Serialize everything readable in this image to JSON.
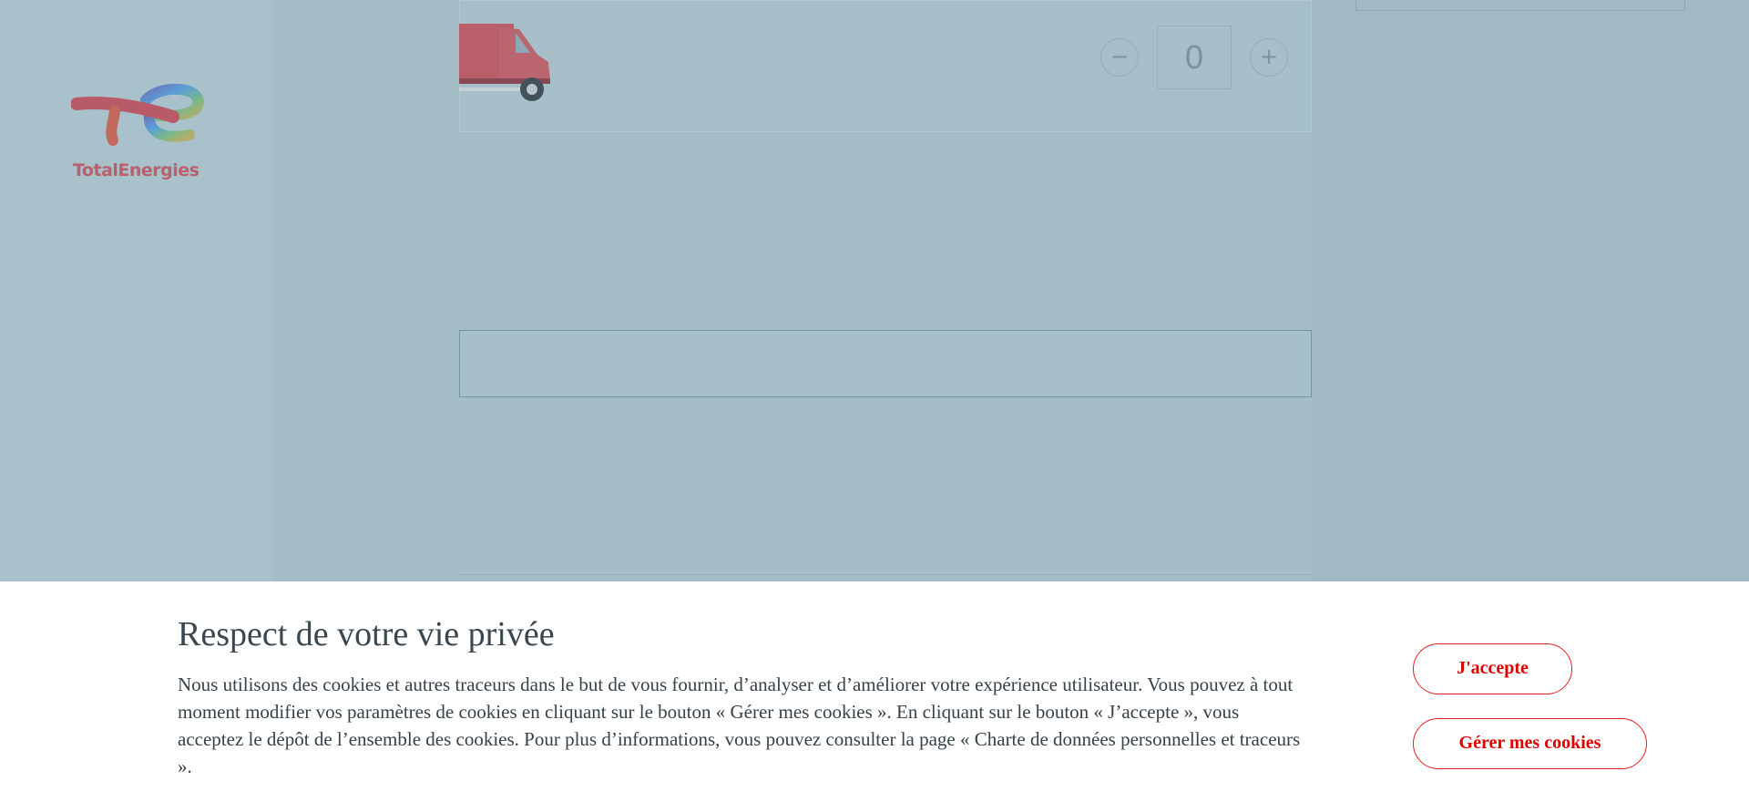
{
  "brand": {
    "logo_text": "TotalEnergies"
  },
  "product": {
    "quantity": "0",
    "minus_symbol": "−",
    "plus_symbol": "+",
    "icon": "truck-icon"
  },
  "cookie_banner": {
    "title": "Respect de votre vie privée",
    "text": "Nous utilisons des cookies et autres traceurs dans le but de vous fournir, d’analyser et d’améliorer votre expérience utilisateur. Vous pouvez à tout moment modifier vos paramètres de cookies en cliquant sur le bouton « Gérer mes cookies ». En cliquant sur le bouton « J’accepte », vous acceptez le dépôt de l’ensemble des cookies. Pour plus d’informations, vous pouvez consulter la page « Charte de données personnelles et traceurs ».",
    "accept_label": "J'accepte",
    "manage_label": "Gérer mes cookies"
  },
  "colors": {
    "accent": "#e00000",
    "overlay": "#a7bfc8"
  }
}
